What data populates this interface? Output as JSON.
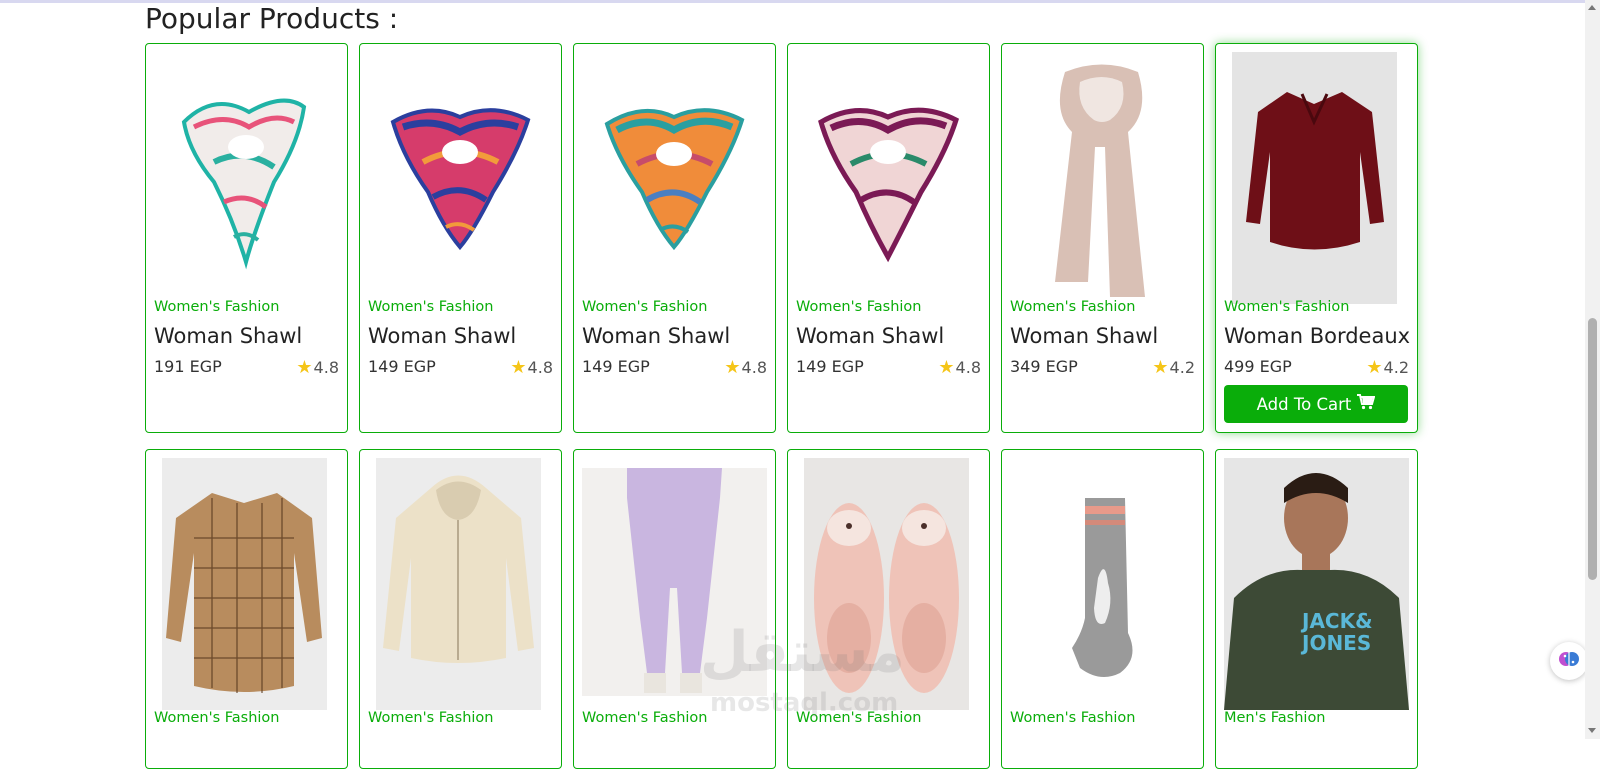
{
  "section": {
    "heading": "Popular Products :"
  },
  "products_row1": [
    {
      "category": "Women's Fashion",
      "title": "Woman Shawl",
      "price": "191 EGP",
      "rating": "4.8",
      "image": "floral-white-scarf"
    },
    {
      "category": "Women's Fashion",
      "title": "Woman Shawl",
      "price": "149 EGP",
      "rating": "4.8",
      "image": "blue-pink-scarf"
    },
    {
      "category": "Women's Fashion",
      "title": "Woman Shawl",
      "price": "149 EGP",
      "rating": "4.8",
      "image": "orange-teal-scarf"
    },
    {
      "category": "Women's Fashion",
      "title": "Woman Shawl",
      "price": "149 EGP",
      "rating": "4.8",
      "image": "purple-floral-scarf"
    },
    {
      "category": "Women's Fashion",
      "title": "Woman Shawl",
      "price": "349 EGP",
      "rating": "4.2",
      "image": "beige-long-shawl"
    },
    {
      "category": "Women's Fashion",
      "title": "Woman Bordeaux",
      "price": "499 EGP",
      "rating": "4.2",
      "image": "bordeaux-shirt",
      "add_to_cart": "Add To Cart"
    }
  ],
  "products_row2": [
    {
      "category": "Women's Fashion",
      "image": "brown-plaid-shirt"
    },
    {
      "category": "Women's Fashion",
      "image": "cream-hoodie"
    },
    {
      "category": "Women's Fashion",
      "image": "lilac-joggers"
    },
    {
      "category": "Women's Fashion",
      "image": "pink-fluffy-slippers"
    },
    {
      "category": "Women's Fashion",
      "image": "grey-sock"
    },
    {
      "category": "Men's Fashion",
      "image": "jack-jones-tshirt"
    }
  ],
  "watermark": {
    "arabic": "مستقل",
    "latin": "mostaql.com"
  },
  "colors": {
    "accent": "#0aad0a",
    "star": "#f5c518"
  },
  "icons": {
    "cart": "cart-icon",
    "star": "star-icon",
    "assistant": "brain-icon"
  }
}
